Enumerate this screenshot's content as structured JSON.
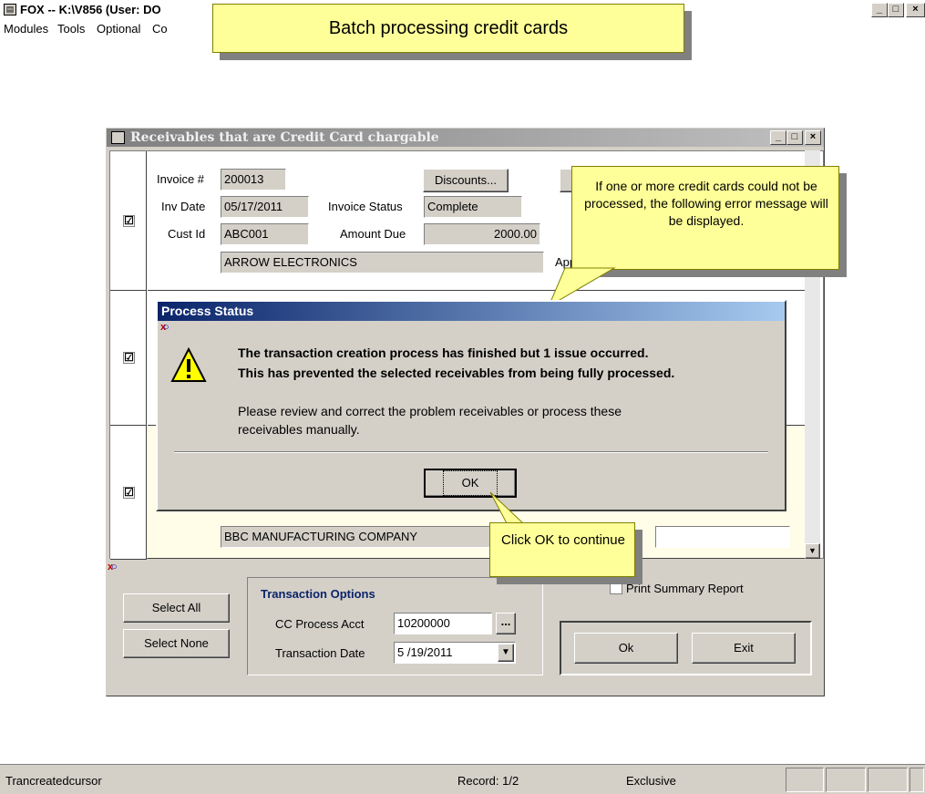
{
  "app": {
    "title": "FOX -- K:\\V856  (User: DO",
    "icon": "app-window-icon",
    "controls": [
      "_",
      "□",
      "×"
    ]
  },
  "menu": [
    "Modules",
    "Tools",
    "Optional",
    "Co"
  ],
  "callout_top": {
    "text": "Batch processing credit cards"
  },
  "receivables": {
    "title": "Receivables that are Credit Card chargable",
    "rows": [
      {
        "checked": "☑",
        "invoice_label": "Invoice #",
        "invoice": "200013",
        "inv_date_label": "Inv Date",
        "inv_date": "05/17/2011",
        "status_label": "Invoice Status",
        "status": "Complete",
        "cust_label": "Cust Id",
        "cust": "ABC001",
        "amount_label": "Amount Due",
        "amount": "2000.00",
        "customer_name": "ARROW ELECTRONICS",
        "discounts_button": "Discounts...",
        "approval_label": "Appr"
      },
      {
        "checked": "☑"
      },
      {
        "checked": "☑",
        "customer_name": "BBC MANUFACTURING COMPANY"
      }
    ],
    "select_all": "Select All",
    "select_none": "Select None",
    "transaction_options": {
      "title": "Transaction Options",
      "cc_label": "CC Process Acct",
      "cc_value": "10200000",
      "cc_browse": "...",
      "date_label": "Transaction Date",
      "date_value": "5 /19/2011"
    },
    "print_summary": "Print Summary Report",
    "ok_button": "Ok",
    "exit_button": "Exit"
  },
  "callout_right": {
    "text": "If one or more credit cards could not be processed, the following error message will be displayed."
  },
  "dialog": {
    "title": "Process Status",
    "line1": "The transaction creation process has finished but 1 issue occurred.",
    "line2": "This has prevented the selected receivables from being fully processed.",
    "line3": "Please review and correct the problem receivables or process these",
    "line4": "receivables manually.",
    "ok_button": "OK",
    "icon": "warning-icon"
  },
  "callout_bottom": {
    "text": "Click OK to continue"
  },
  "status": {
    "left": "Trancreatedcursor",
    "record": "Record: 1/2",
    "mode": "Exclusive"
  },
  "colors": {
    "callout": "#ffff99",
    "dialog_title": "#0a246a",
    "window_bg": "#d4d0c8"
  }
}
